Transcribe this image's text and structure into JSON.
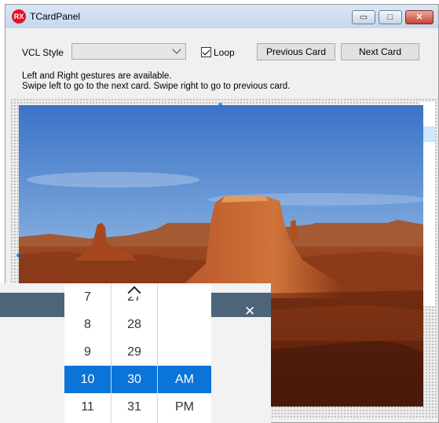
{
  "window": {
    "title": "TCardPanel",
    "app_icon_text": "RX",
    "min_glyph": "▭",
    "max_glyph": "□",
    "close_glyph": "✕"
  },
  "toolbar": {
    "vcl_style_label": "VCL Style",
    "vcl_style_value": "",
    "loop_label": "Loop",
    "loop_checked": true,
    "previous_label": "Previous Card",
    "next_label": "Next Card"
  },
  "info": {
    "line1": "Left and Right gestures are available.",
    "line2": "Swipe left to go to the next card. Swipe right to go to previous card."
  },
  "overlay_window": {
    "close_glyph": "✕"
  },
  "picker": {
    "hours": [
      "7",
      "8",
      "9",
      "10",
      "11"
    ],
    "minutes": [
      "27",
      "28",
      "29",
      "30",
      "31"
    ],
    "periods": [
      "AM",
      "PM"
    ],
    "selected_hour": "10",
    "selected_minute": "30",
    "selected_period": "AM"
  },
  "colors": {
    "accent": "#0a74d8",
    "overlay_bar": "#4e6478",
    "close_button": "#c8432d"
  },
  "icons": {
    "app": "rx-logo-icon",
    "combo_arrow": "chevron-down-icon",
    "picker_up": "chevron-up-icon"
  }
}
